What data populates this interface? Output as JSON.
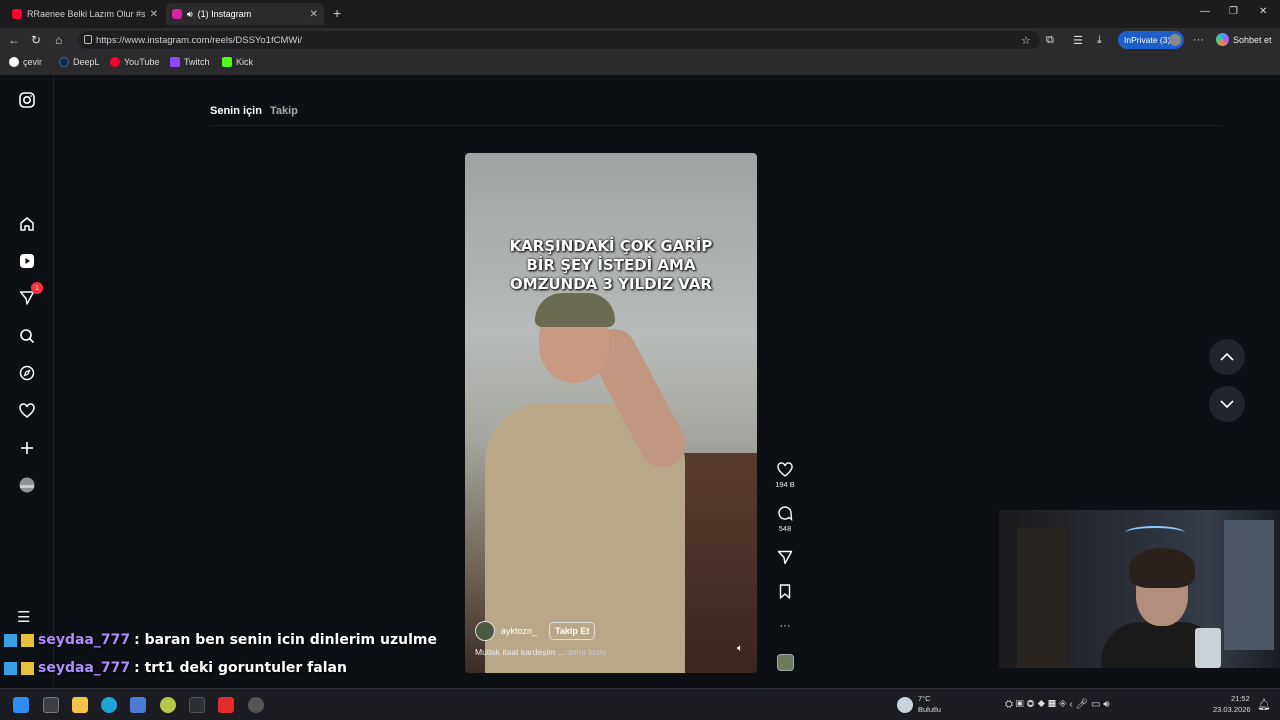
{
  "browser": {
    "tabs": [
      {
        "title": "RRaenee Belki Lazım Olur #shorts",
        "color": "#ff0033"
      },
      {
        "title": "(1) Instagram",
        "color": "#d6249f"
      }
    ],
    "url": "https://www.instagram.com/reels/DSSYo1fCMWi/",
    "inprivate_label": "InPrivate (3)",
    "copilot_label": "Sohbet et",
    "bookmarks": [
      {
        "label": "çevir",
        "color": "#ffffff"
      },
      {
        "label": "DeepL",
        "color": "#0f2b46"
      },
      {
        "label": "YouTube",
        "color": "#ff0033"
      },
      {
        "label": "Twitch",
        "color": "#9146ff"
      },
      {
        "label": "Kick",
        "color": "#53fc18"
      }
    ]
  },
  "instagram": {
    "feed_tabs": {
      "active": "Senin için",
      "other": "Takip"
    },
    "notification_count": "1",
    "reel": {
      "caption_lines": [
        "KARŞINDAKİ ÇOK GARİP",
        "BİR ŞEY İSTEDİ AMA",
        "OMZUNDA 3 YILDIZ VAR"
      ],
      "author": "ayktozn_",
      "follow_label": "Takip Et",
      "description": "Mutlak itaat kardeşim ...",
      "more_label": "daha fazla"
    },
    "actions": {
      "likes": "194 B",
      "comments": "548"
    }
  },
  "chat": [
    {
      "nick": "seydaa_777",
      "message": ": baran ben senin icin dinlerim uzulme"
    },
    {
      "nick": "seydaa_777",
      "message": ": trt1 deki goruntuler falan"
    }
  ],
  "taskbar": {
    "weather_temp": "7°C",
    "weather_desc": "Bulutlu",
    "time": "21:52",
    "date": "23.03.2026"
  }
}
